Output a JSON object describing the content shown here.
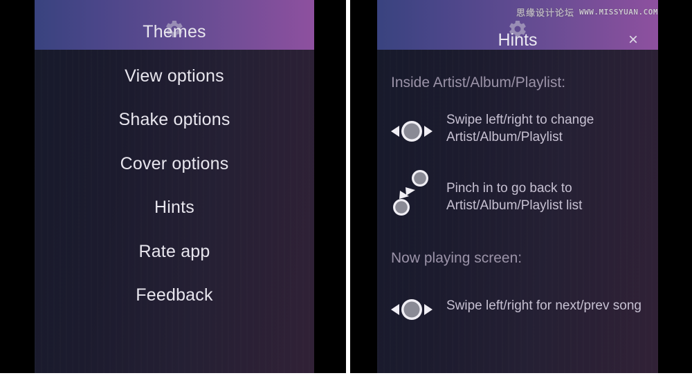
{
  "watermark": {
    "chinese": "思缘设计论坛",
    "english": "WWW.MISSYUAN.COM"
  },
  "theme": {
    "header_gradient_start": "#39437f",
    "header_gradient_end": "#8e509f",
    "body_gradient_start": "#171a2b",
    "body_gradient_end": "#312136",
    "text_primary": "#e8e6ee",
    "text_secondary": "#c7c1d2",
    "text_muted": "#9b93a8",
    "icon_fill": "#8f8f99"
  },
  "left_panel": {
    "header": {
      "icon": "gear-icon"
    },
    "menu": {
      "items": [
        {
          "label": "Themes"
        },
        {
          "label": "View options"
        },
        {
          "label": "Shake options"
        },
        {
          "label": "Cover options"
        },
        {
          "label": "Hints"
        },
        {
          "label": "Rate app"
        },
        {
          "label": "Feedback"
        }
      ]
    }
  },
  "right_panel": {
    "header": {
      "icon": "gear-icon"
    },
    "dialog": {
      "title": "Hints",
      "close_label": "×",
      "sections": [
        {
          "heading": "Inside Artist/Album/Playlist:",
          "hints": [
            {
              "icon": "swipe-horizontal-icon",
              "text": "Swipe left/right to change Artist/Album/Playlist"
            },
            {
              "icon": "pinch-in-icon",
              "text": "Pinch in to go back to Artist/Album/Playlist list"
            }
          ]
        },
        {
          "heading": "Now playing screen:",
          "hints": [
            {
              "icon": "swipe-horizontal-icon",
              "text": "Swipe left/right for next/prev song"
            }
          ]
        }
      ]
    }
  }
}
